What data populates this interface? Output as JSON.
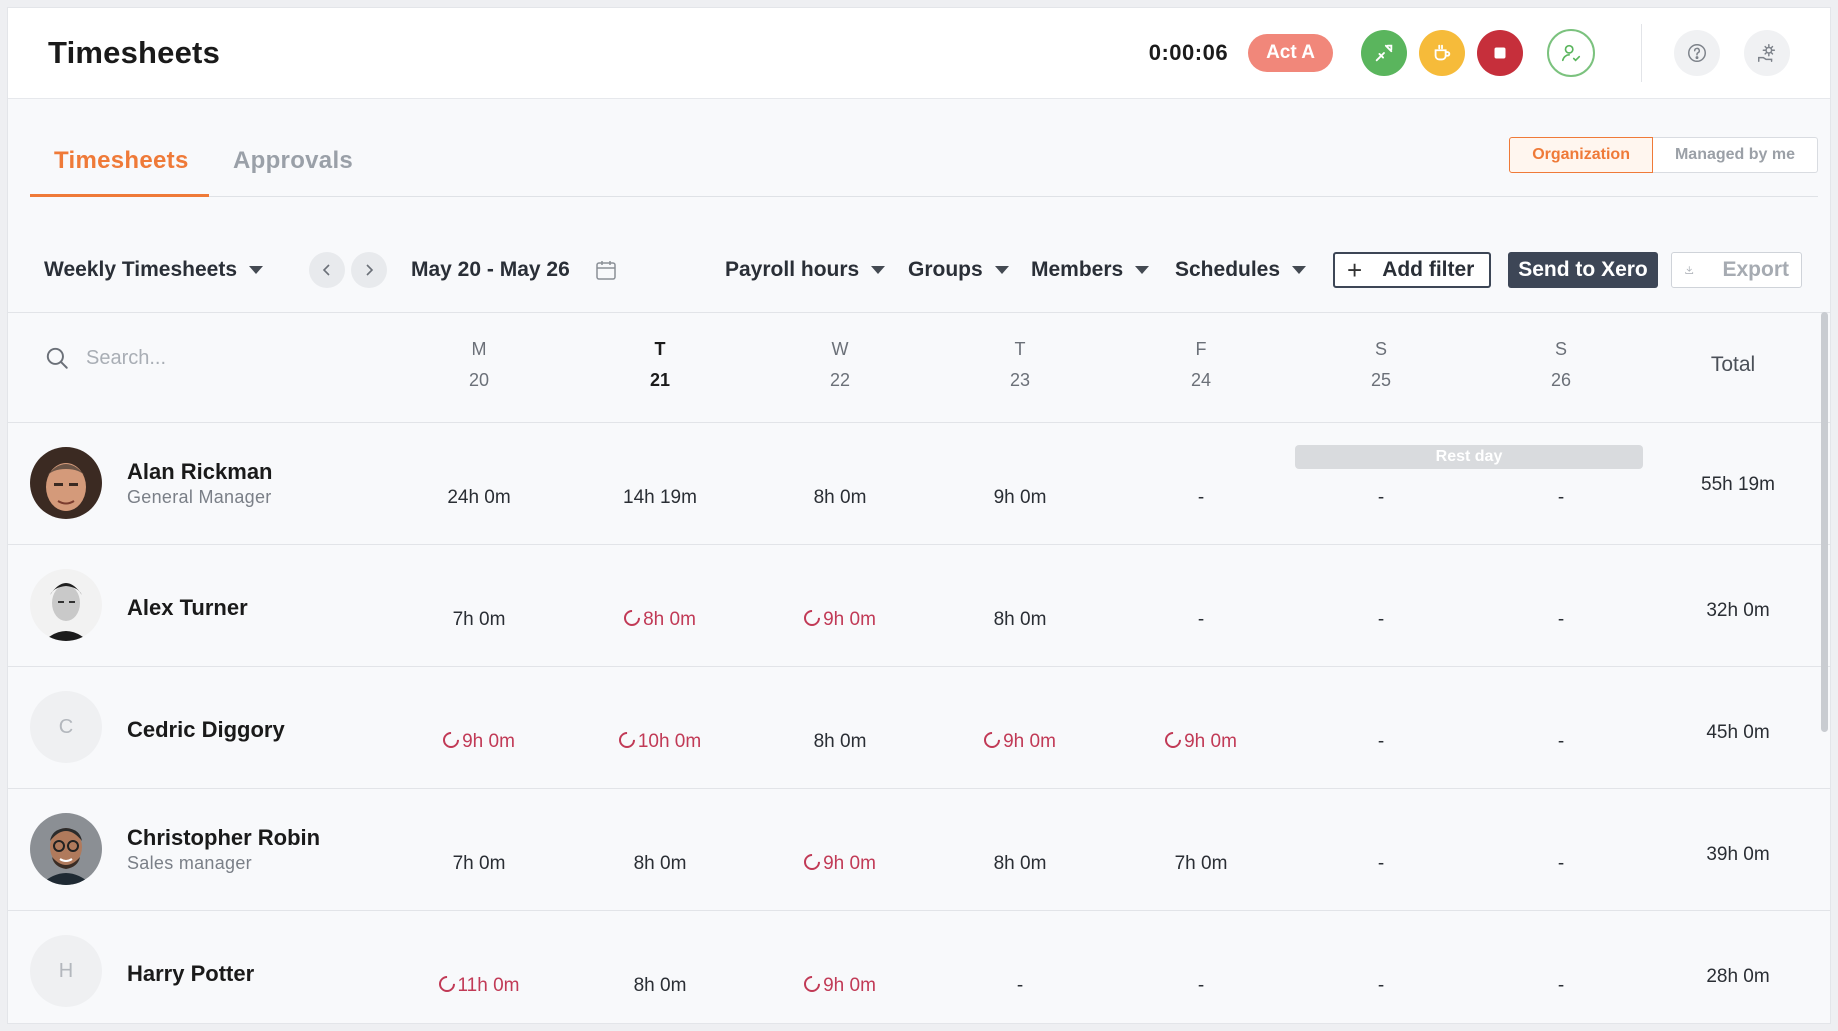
{
  "header": {
    "title": "Timesheets",
    "timer": "0:00:06",
    "activity_pill": "Act A"
  },
  "tabs": [
    {
      "label": "Timesheets",
      "active": true
    },
    {
      "label": "Approvals",
      "active": false
    }
  ],
  "scope": {
    "options": [
      "Organization",
      "Managed by me"
    ],
    "selected": "Organization"
  },
  "filters": {
    "view": "Weekly Timesheets",
    "date_range": "May 20 - May 26",
    "payroll": "Payroll hours",
    "groups": "Groups",
    "members": "Members",
    "schedules": "Schedules",
    "add_filter": "Add filter",
    "send": "Send to Xero",
    "export": "Export"
  },
  "table": {
    "search_placeholder": "Search...",
    "total_label": "Total",
    "days": [
      {
        "letter": "M",
        "num": "20",
        "today": false
      },
      {
        "letter": "T",
        "num": "21",
        "today": true
      },
      {
        "letter": "W",
        "num": "22",
        "today": false
      },
      {
        "letter": "T",
        "num": "23",
        "today": false
      },
      {
        "letter": "F",
        "num": "24",
        "today": false
      },
      {
        "letter": "S",
        "num": "25",
        "today": false
      },
      {
        "letter": "S",
        "num": "26",
        "today": false
      }
    ],
    "rest_day_label": "Rest day",
    "rows": [
      {
        "name": "Alan Rickman",
        "role": "General Manager",
        "initial": "",
        "cells": [
          {
            "v": "24h 0m",
            "ot": false
          },
          {
            "v": "14h 19m",
            "ot": false
          },
          {
            "v": "8h 0m",
            "ot": false
          },
          {
            "v": "9h 0m",
            "ot": false
          },
          {
            "v": "-",
            "ot": false
          },
          {
            "v": "-",
            "ot": false
          },
          {
            "v": "-",
            "ot": false
          }
        ],
        "total": "55h 19m"
      },
      {
        "name": "Alex Turner",
        "role": "",
        "initial": "",
        "cells": [
          {
            "v": "7h 0m",
            "ot": false
          },
          {
            "v": "8h 0m",
            "ot": true
          },
          {
            "v": "9h 0m",
            "ot": true
          },
          {
            "v": "8h 0m",
            "ot": false
          },
          {
            "v": "-",
            "ot": false
          },
          {
            "v": "-",
            "ot": false
          },
          {
            "v": "-",
            "ot": false
          }
        ],
        "total": "32h 0m"
      },
      {
        "name": "Cedric Diggory",
        "role": "",
        "initial": "C",
        "cells": [
          {
            "v": "9h 0m",
            "ot": true
          },
          {
            "v": "10h 0m",
            "ot": true
          },
          {
            "v": "8h 0m",
            "ot": false
          },
          {
            "v": "9h 0m",
            "ot": true
          },
          {
            "v": "9h 0m",
            "ot": true
          },
          {
            "v": "-",
            "ot": false
          },
          {
            "v": "-",
            "ot": false
          }
        ],
        "total": "45h 0m"
      },
      {
        "name": "Christopher Robin",
        "role": "Sales manager",
        "initial": "",
        "cells": [
          {
            "v": "7h 0m",
            "ot": false
          },
          {
            "v": "8h 0m",
            "ot": false
          },
          {
            "v": "9h 0m",
            "ot": true
          },
          {
            "v": "8h 0m",
            "ot": false
          },
          {
            "v": "7h 0m",
            "ot": false
          },
          {
            "v": "-",
            "ot": false
          },
          {
            "v": "-",
            "ot": false
          }
        ],
        "total": "39h 0m"
      },
      {
        "name": "Harry Potter",
        "role": "",
        "initial": "H",
        "cells": [
          {
            "v": "11h 0m",
            "ot": true
          },
          {
            "v": "8h 0m",
            "ot": false
          },
          {
            "v": "9h 0m",
            "ot": true
          },
          {
            "v": "-",
            "ot": false
          },
          {
            "v": "-",
            "ot": false
          },
          {
            "v": "-",
            "ot": false
          },
          {
            "v": "-",
            "ot": false
          }
        ],
        "total": "28h 0m"
      }
    ]
  },
  "colors": {
    "accent": "#ef7a38",
    "overtime": "#c13a56",
    "primary_dark": "#3d4656"
  },
  "icons": {
    "top_actions": [
      "switch-activity-icon",
      "break-coffee-icon",
      "stop-icon",
      "user-clock-icon",
      "help-icon",
      "settings-icon"
    ]
  }
}
